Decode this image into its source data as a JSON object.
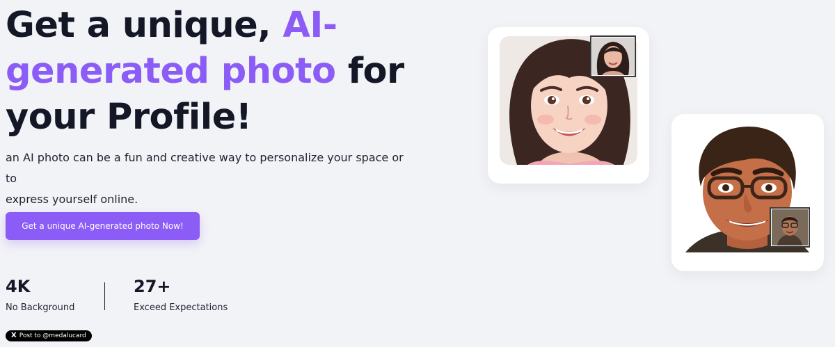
{
  "hero": {
    "title_line1": "Get a unique, ",
    "title_accent1": "AI-",
    "title_accent2": "generated photo",
    "title_rest2": " for",
    "title_line3": "your Profile!",
    "subtitle_line1": "an AI photo can be a fun and creative way to personalize your space or to",
    "subtitle_line2": "express yourself online.",
    "cta_label": "Get a unique AI-generated photo Now!"
  },
  "stats": [
    {
      "value": "4K",
      "label": "No Background"
    },
    {
      "value": "27+",
      "label": "Exceed Expectations"
    }
  ],
  "social": {
    "logo": "X",
    "label": "Post to @medalucard"
  },
  "colors": {
    "accent": "#8b5cf6",
    "text": "#141826",
    "background": "#f2f3f7"
  },
  "images": {
    "woman_card": "ai-generated-woman-portrait",
    "woman_inset": "woman-reference-photo",
    "man_card": "ai-generated-man-portrait",
    "man_inset": "man-reference-photo"
  }
}
